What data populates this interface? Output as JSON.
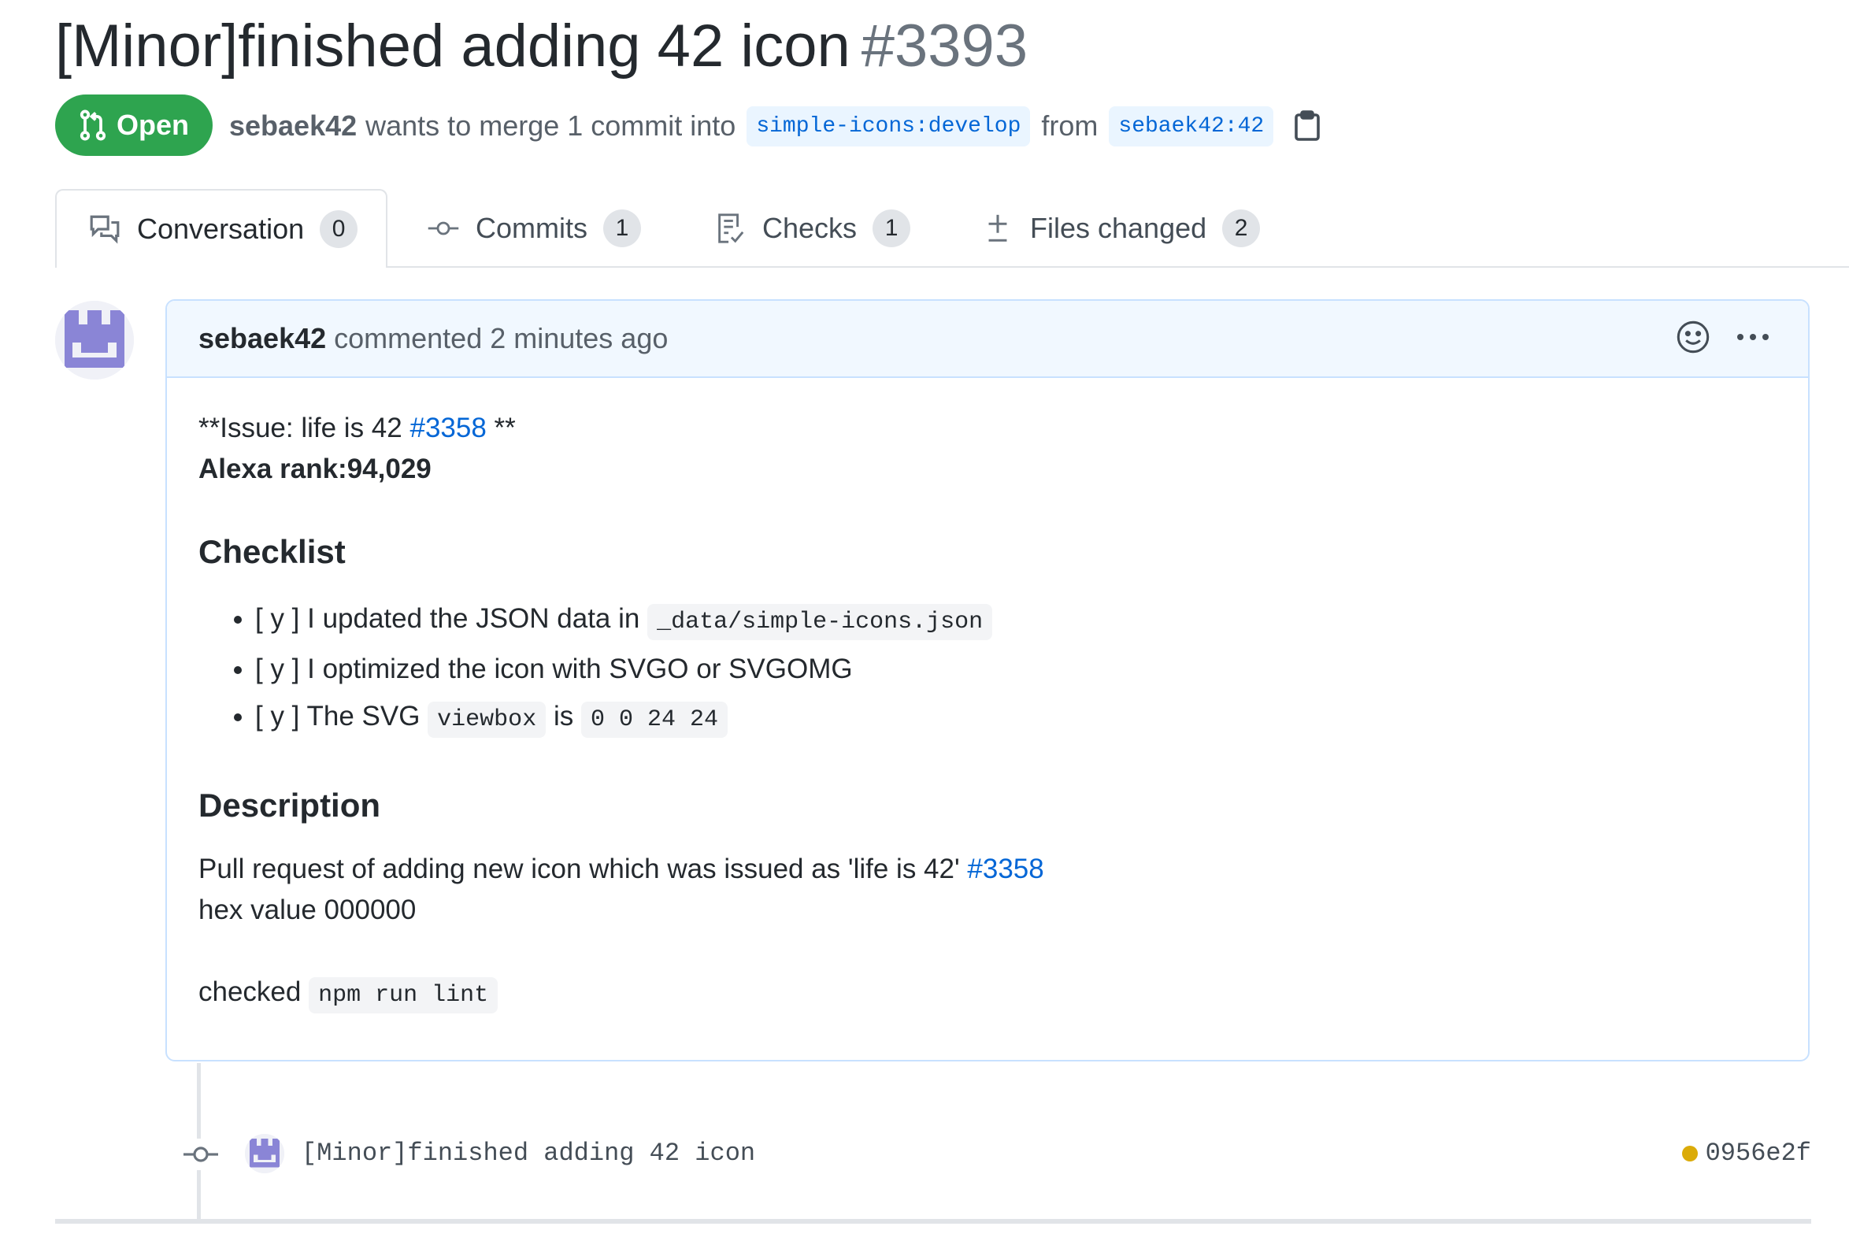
{
  "pr": {
    "title": "[Minor]finished adding 42 icon",
    "number": "#3393",
    "state": "Open",
    "author": "sebaek42",
    "merge_text": "wants to merge 1 commit into",
    "base_branch": "simple-icons:develop",
    "from_text": "from",
    "head_branch": "sebaek42:42"
  },
  "tabs": [
    {
      "label": "Conversation",
      "count": "0",
      "icon": "comment-discussion-icon"
    },
    {
      "label": "Commits",
      "count": "1",
      "icon": "git-commit-icon"
    },
    {
      "label": "Checks",
      "count": "1",
      "icon": "checklist-icon"
    },
    {
      "label": "Files changed",
      "count": "2",
      "icon": "diff-icon"
    }
  ],
  "comment": {
    "author": "sebaek42",
    "meta": "commented 2 minutes ago",
    "issue_prefix": "**Issue: life is 42",
    "issue_link": "#3358",
    "issue_suffix": "**",
    "alexa": "Alexa rank:94,029",
    "checklist_heading": "Checklist",
    "checklist": [
      {
        "text": "[ y ] I updated the JSON data in",
        "code": "_data/simple-icons.json"
      },
      {
        "text": "[ y ] I optimized the icon with SVGO or SVGOMG"
      },
      {
        "text": "[ y ] The SVG",
        "code": "viewbox",
        "mid": "is",
        "code2": "0 0 24 24"
      }
    ],
    "description_heading": "Description",
    "description_text": "Pull request of adding new icon which was issued as 'life is 42'",
    "description_link": "#3358",
    "hex_line": "hex value 000000",
    "checked_text": "checked",
    "checked_code": "npm run lint"
  },
  "commit": {
    "message": "[Minor]finished adding 42 icon",
    "sha": "0956e2f",
    "status_color": "#dbab09"
  },
  "colors": {
    "open_green": "#2ea44f",
    "link_blue": "#0366d6",
    "header_blue": "#f1f8ff",
    "avatar_purple": "#8a85d6"
  }
}
